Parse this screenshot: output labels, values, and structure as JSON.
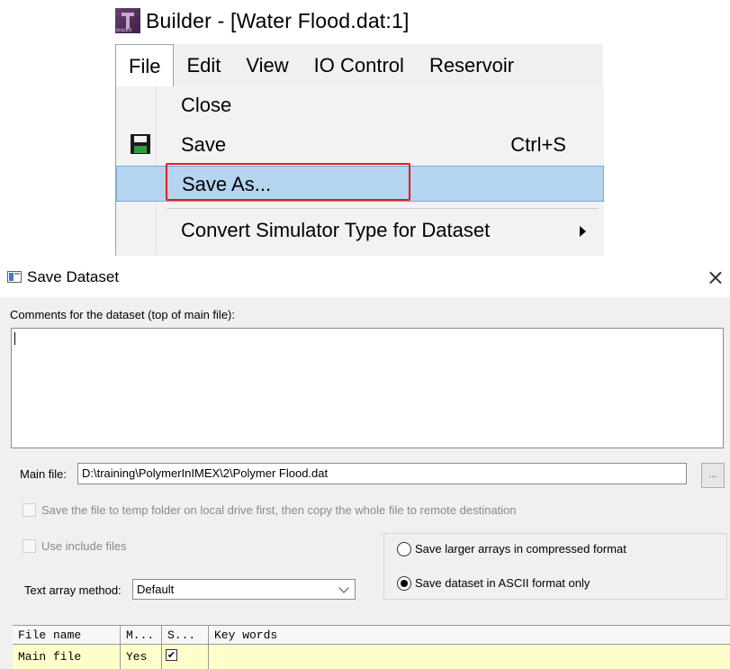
{
  "builder": {
    "title": "Builder - [Water Flood.dat:1]",
    "menubar": [
      "File",
      "Edit",
      "View",
      "IO Control",
      "Reservoir"
    ],
    "file_menu": {
      "close": "Close",
      "save": "Save",
      "save_shortcut": "Ctrl+S",
      "save_as": "Save As...",
      "convert": "Convert Simulator Type for Dataset"
    }
  },
  "dialog": {
    "title": "Save Dataset",
    "comments_label": "Comments for the dataset (top of main file):",
    "comments_value": "",
    "main_file_label": "Main file:",
    "main_file_value": "D:\\training\\PolymerInIMEX\\2\\Polymer Flood.dat",
    "browse_label": "...",
    "temp_folder_label": "Save the file to temp folder on local drive first, then copy the whole file to remote destination",
    "include_files_label": "Use include files",
    "radio_compressed": "Save larger arrays in compressed format",
    "radio_ascii": "Save dataset in ASCII format only",
    "selected_format": "ascii",
    "text_array_label": "Text array method:",
    "text_array_value": "Default",
    "table": {
      "headers": [
        "File name",
        "M...",
        "S...",
        "Key words"
      ],
      "rows": [
        {
          "file_name": "Main file",
          "m": "Yes",
          "s_checked": true,
          "s_mark": "✔",
          "key_words": ""
        }
      ]
    }
  }
}
